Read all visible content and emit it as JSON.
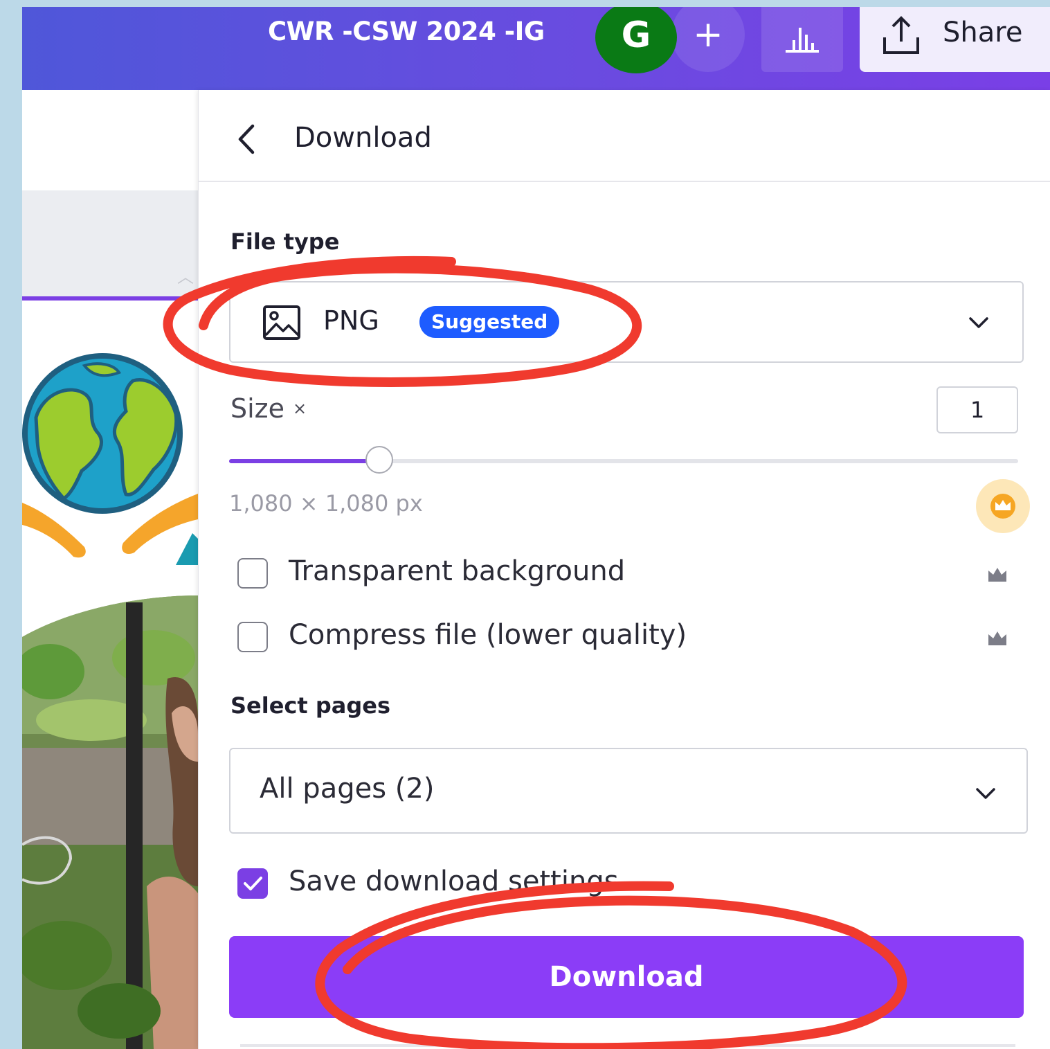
{
  "topbar": {
    "title": "CWR -CSW 2024 -IG",
    "avatar_initial": "G",
    "add_label": "+",
    "share_label": "Share",
    "gradient_colors": [
      "#4f57d9",
      "#7a3fe6"
    ]
  },
  "panel": {
    "title": "Download",
    "file_type_label": "File type",
    "file_type_value": "PNG",
    "suggested_badge": "Suggested",
    "size_label": "Size",
    "size_symbol": "×",
    "size_value": "1",
    "size_slider_fraction": 0.19,
    "dimensions": "1,080 × 1,080 px",
    "options": [
      {
        "label": "Transparent background",
        "checked": false,
        "pro": true
      },
      {
        "label": "Compress file (lower quality)",
        "checked": false,
        "pro": true
      }
    ],
    "select_pages_label": "Select pages",
    "select_pages_value": "All pages (2)",
    "save_settings_label": "Save download settings",
    "save_settings_checked": true,
    "download_button": "Download"
  },
  "colors": {
    "accent": "#7b3fe4",
    "download_button": "#8b3df7",
    "suggested_badge": "#1e5cff",
    "annotation_marker": "#f03a2e",
    "avatar": "#0a7a15"
  },
  "icons": {
    "back": "chevron-left-icon",
    "file_type": "image-icon",
    "dropdown": "chevron-down-icon",
    "pro": "crown-icon",
    "share": "upload-icon",
    "insights": "bar-chart-icon"
  }
}
